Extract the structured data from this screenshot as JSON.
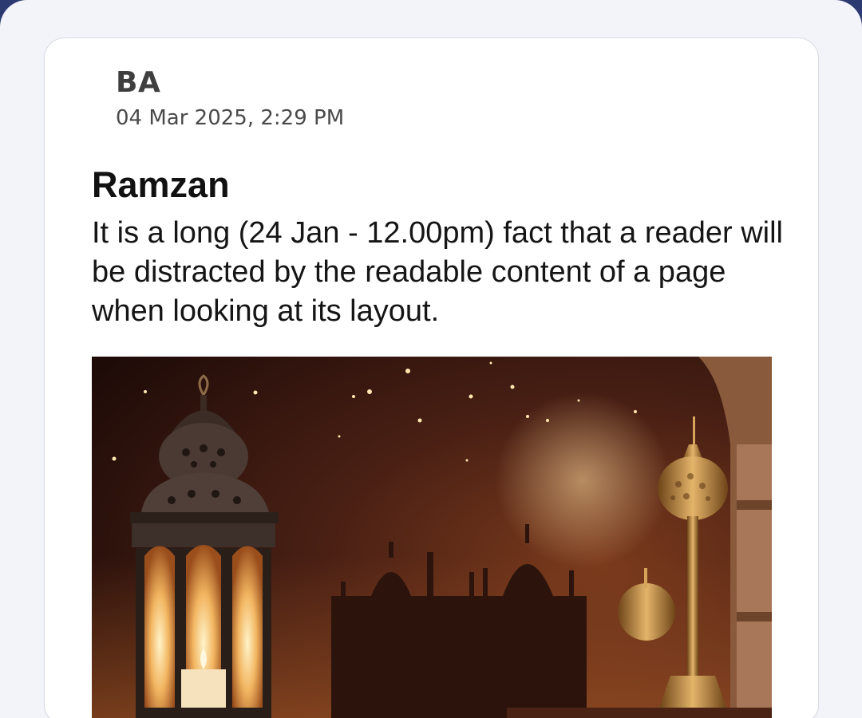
{
  "post": {
    "author": "BA",
    "timestamp": "04 Mar 2025, 2:29 PM",
    "title": "Ramzan",
    "body": "It is a long (24 Jan - 12.00pm) fact that a reader will be distracted by the readable content of a page when looking at its layout.",
    "image": {
      "subject": "lantern-crescent-moon-mosque-illustration"
    }
  }
}
